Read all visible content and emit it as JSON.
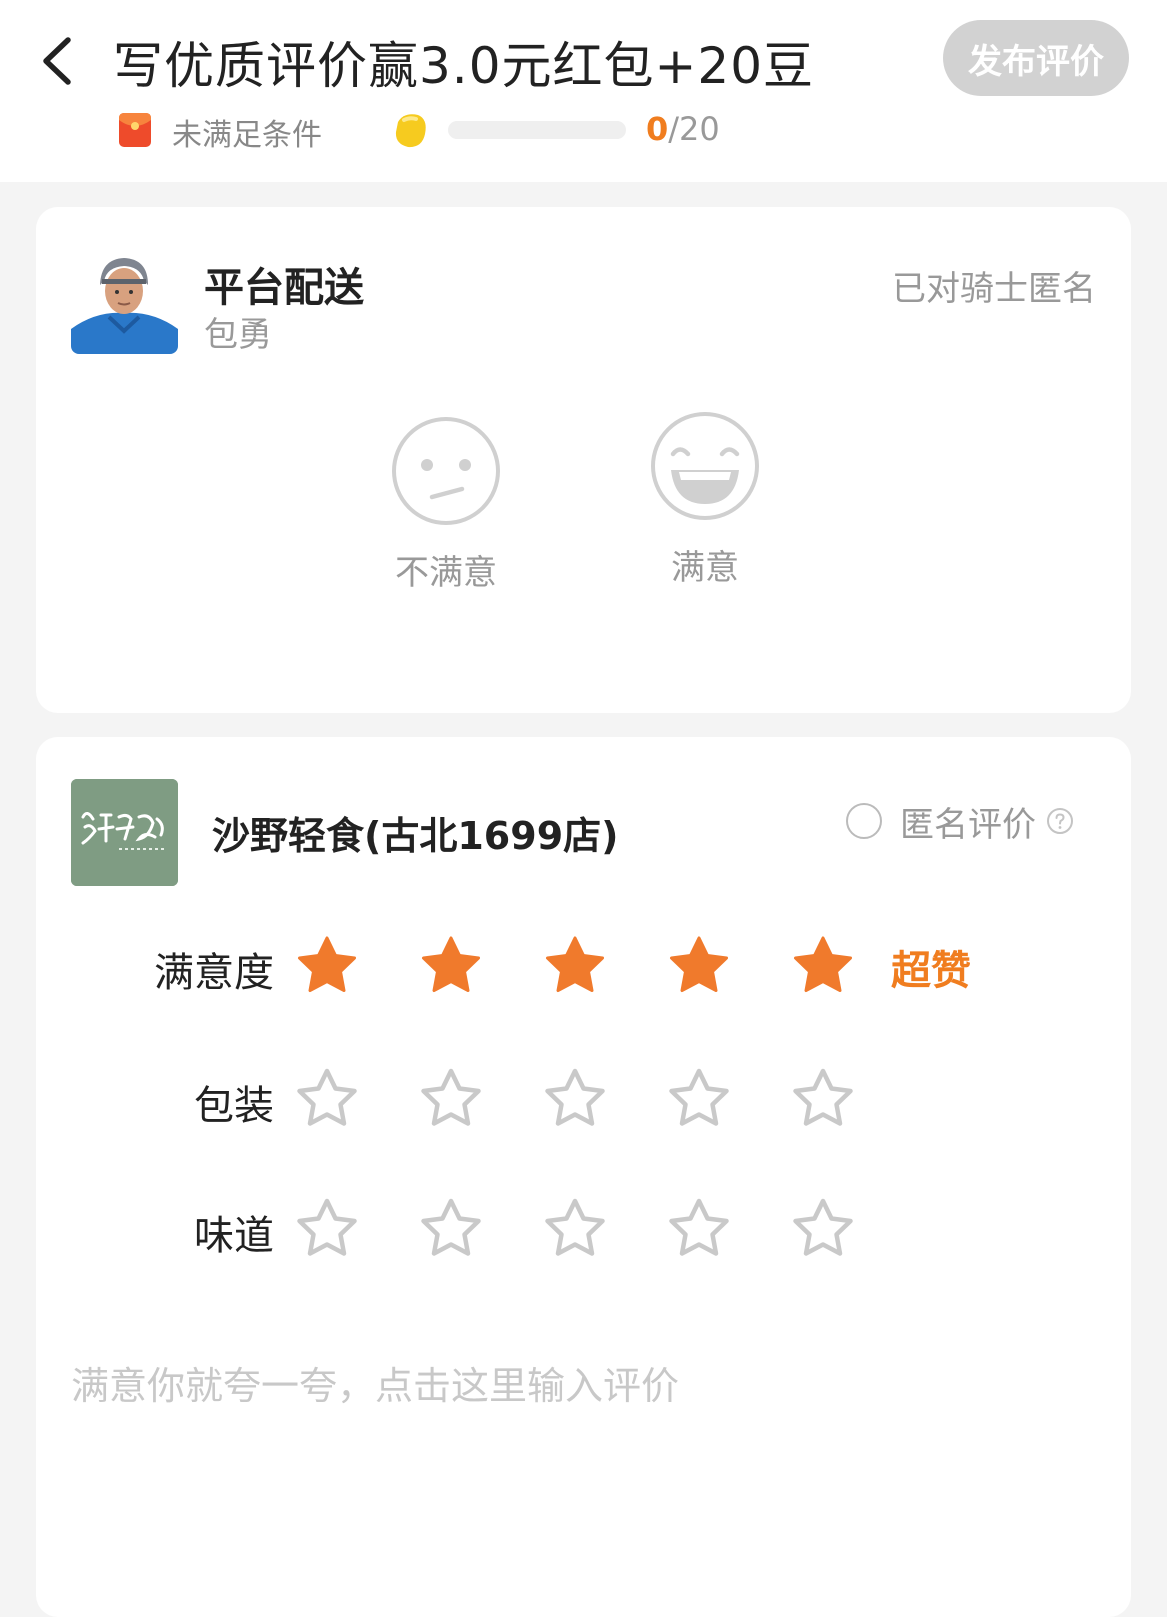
{
  "header": {
    "title": "写优质评价赢3.0元红包+20豆",
    "publish_label": "发布评价",
    "condition_text": "未满足条件",
    "progress": {
      "current": "0",
      "separator": "/",
      "total": "20",
      "fraction": 0.0
    }
  },
  "delivery": {
    "title": "平台配送",
    "rider_name": "包勇",
    "anonymous_note": "已对骑士匿名",
    "options": [
      {
        "label": "不满意",
        "icon": "neutral-face-icon"
      },
      {
        "label": "满意",
        "icon": "laughing-face-icon"
      }
    ]
  },
  "shop": {
    "name": "沙野轻食(古北1699店)",
    "logo_text": "沙野轻食",
    "anonymous_label": "匿名评价",
    "anonymous_checked": false,
    "ratings": [
      {
        "label": "满意度",
        "score": 5,
        "max": 5,
        "word": "超赞"
      },
      {
        "label": "包装",
        "score": 0,
        "max": 5,
        "word": ""
      },
      {
        "label": "味道",
        "score": 0,
        "max": 5,
        "word": ""
      }
    ],
    "review_placeholder": "满意你就夸一夸，点击这里输入评价",
    "review_value": ""
  },
  "colors": {
    "accent": "#f07d1f",
    "star_filled": "#f07a2c",
    "star_empty": "#c9c9c9",
    "button_disabled": "#d2d2d2",
    "background": "#f4f4f4"
  }
}
